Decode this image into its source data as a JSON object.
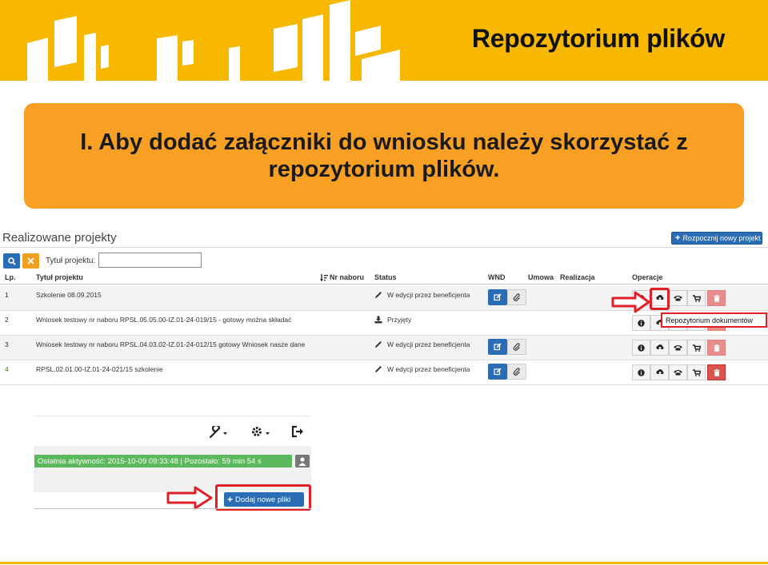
{
  "slide": {
    "title": "Repozytorium plików",
    "banner_text": "I. Aby dodać załączniki do wniosku należy skorzystać z repozytorium plików.",
    "brand_color": "#f8b800",
    "banner_color": "#f8a024",
    "annotation_color": "#e21f26"
  },
  "projects": {
    "section_title": "Realizowane projekty",
    "new_project_button": "Rozpocznij nowy projekt",
    "search_label": "Tytuł projektu:",
    "search_value": "",
    "columns": {
      "lp": "Lp.",
      "title": "Tytuł projektu",
      "nr": "Nr naboru",
      "status": "Status",
      "wnd": "WND",
      "umowa": "Umowa",
      "realizacja": "Realizacja",
      "operacje": "Operacje"
    },
    "rows": [
      {
        "lp": "1",
        "title": "Szkolenie 08.09.2015",
        "status": "W edycji przez beneficjenta",
        "status_icon": "pencil-icon",
        "has_wnd": true
      },
      {
        "lp": "2",
        "title": "Wniosek testowy nr naboru RPSL.05.05.00-IZ.01-24-019/15 - gotowy można składać",
        "status": "Przyjęty",
        "status_icon": "inbox-icon",
        "has_wnd": false
      },
      {
        "lp": "3",
        "title": "Wniosek testowy nr naboru RPSL.04.03.02-IZ.01-24-012/15 gotowy Wniosek nasze dane",
        "status": "W edycji przez beneficjenta",
        "status_icon": "pencil-icon",
        "has_wnd": true
      },
      {
        "lp": "4",
        "title": "RPSL.02.01.00-IZ.01-24-021/15 szkolenie",
        "status": "W edycji przez beneficjenta",
        "status_icon": "pencil-icon",
        "has_wnd": true
      }
    ],
    "tooltip": "Repozytorium dokumentów"
  },
  "repository_panel": {
    "activity_text": "Ostatnia aktywność: 2015-10-09 09:33:48 | Pozostało: 59 min 54 s",
    "add_files_button": "Dodaj nowe pliki",
    "icons": [
      "wrench-icon",
      "gear-icon",
      "logout-icon",
      "user-icon"
    ]
  }
}
